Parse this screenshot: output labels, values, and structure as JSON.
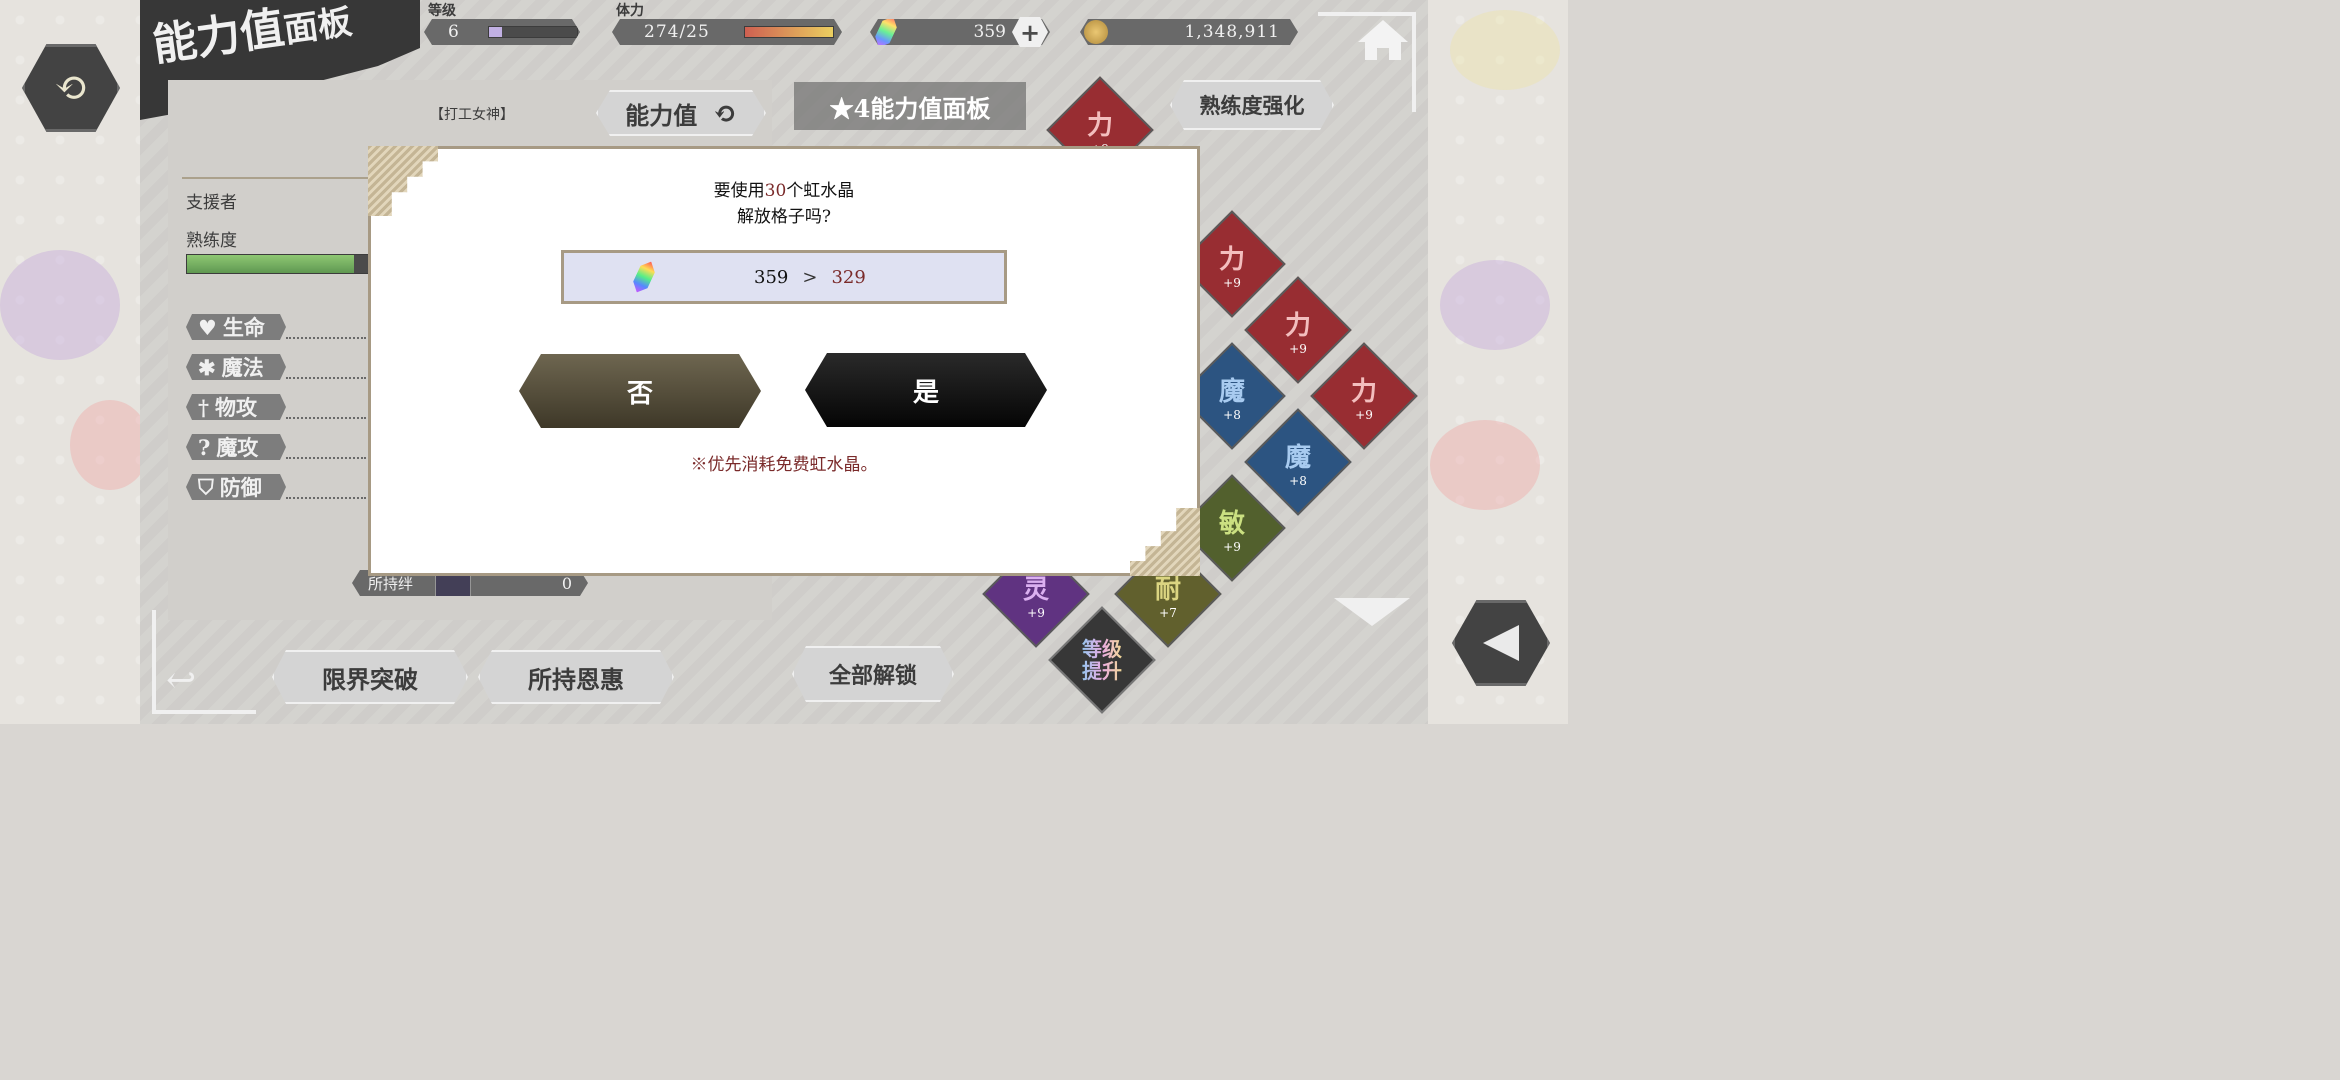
{
  "header": {
    "title_main": "能力值",
    "title_sub": "面板",
    "level_label": "等级",
    "level_value": "6",
    "level_progress": 0.15,
    "stamina_label": "体力",
    "stamina_value": "274/25",
    "gems": "359",
    "coins": "1,348,911",
    "add_symbol": "+"
  },
  "panel": {
    "character_title": "【打工女神】",
    "stats_button": "能力值",
    "role": "支援者",
    "proficiency_label": "熟练度",
    "proficiency_progress": 0.88,
    "stats": [
      "生命",
      "魔法",
      "物攻",
      "魔攻",
      "防御"
    ],
    "bond_label": "所持绊",
    "bond_value": "0"
  },
  "board": {
    "board_title": "★4能力值面板",
    "enhance_button": "熟练度强化",
    "unlock_all_button": "全部解锁",
    "level_up_label": "等级提升",
    "cells": [
      {
        "k": "力",
        "v": "+9",
        "color": "#8a1116"
      },
      {
        "k": "力",
        "v": "+9",
        "color": "#8a1116"
      },
      {
        "k": "力",
        "v": "+9",
        "color": "#8a1116"
      },
      {
        "k": "力",
        "v": "+9",
        "color": "#8a1116"
      },
      {
        "k": "魔",
        "v": "+8",
        "color": "#0f3d70"
      },
      {
        "k": "力",
        "v": "+9",
        "color": "#8a1116"
      },
      {
        "k": "魔",
        "v": "+8",
        "color": "#0f3d70"
      },
      {
        "k": "敏",
        "v": "+9",
        "color": "#3b4a10"
      },
      {
        "k": "灵",
        "v": "+9",
        "color": "#4a1770"
      },
      {
        "k": "耐",
        "v": "+7",
        "color": "#4c4a10"
      }
    ]
  },
  "bottom": {
    "limit_break": "限界突破",
    "blessings": "所持恩惠"
  },
  "dialog": {
    "line1_pre": "要使用",
    "line1_num": "30",
    "line1_post": "个虹水晶",
    "line2": "解放格子吗?",
    "from": "359",
    "arrow": ">",
    "to": "329",
    "no": "否",
    "yes": "是",
    "note": "※优先消耗免费虹水晶。"
  },
  "colors": {
    "accent_red": "#7a2a2a",
    "no_btn": "#5a5240",
    "yes_btn": "#111111"
  }
}
